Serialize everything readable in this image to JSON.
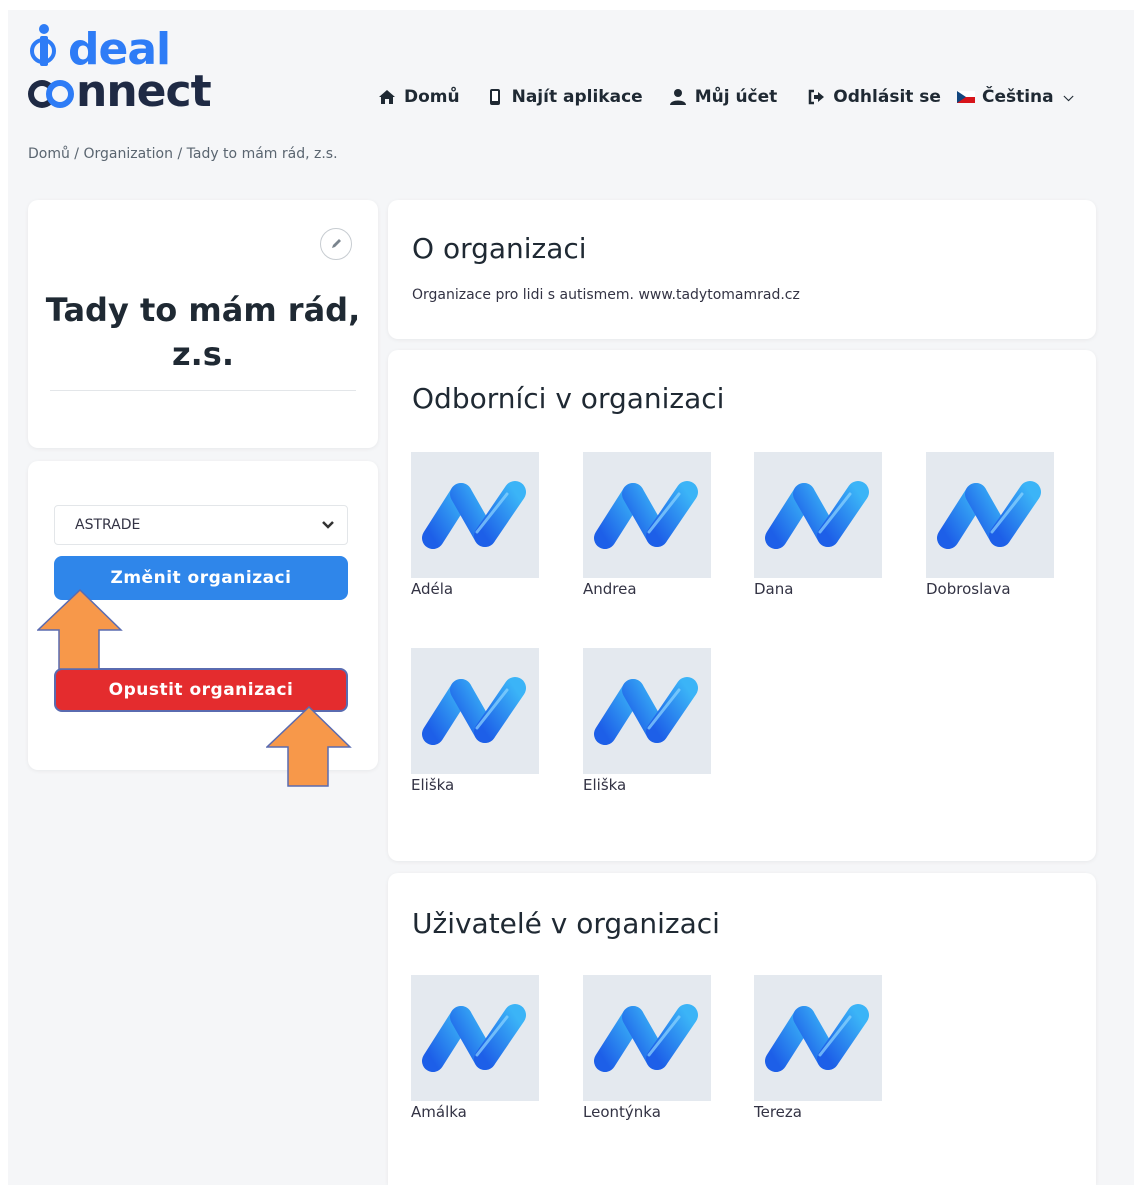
{
  "logo": {
    "line1": "deal",
    "line2": "nnect"
  },
  "nav": {
    "home": "Domů",
    "find_apps": "Najít aplikace",
    "account": "Můj účet",
    "logout": "Odhlásit se",
    "language": "Čeština"
  },
  "breadcrumb": {
    "home": "Domů",
    "sep": " / ",
    "organization": "Organization",
    "current": "Tady to mám rád, z.s."
  },
  "org": {
    "name": "Tady to mám rád, z.s.",
    "select_value": "ASTRADE",
    "change_button": "Změnit organizaci",
    "leave_button": "Opustit organizaci"
  },
  "about": {
    "title": "O organizaci",
    "text": "Organizace pro lidi s autismem. www.tadytomamrad.cz"
  },
  "experts": {
    "title": "Odborníci v organizaci",
    "people": [
      "Adéla",
      "Andrea",
      "Dana",
      "Dobroslava",
      "Eliška",
      "Eliška"
    ]
  },
  "users": {
    "title": "Uživatelé v organizaci",
    "people": [
      "Amálka",
      "Leontýnka",
      "Tereza"
    ]
  },
  "colors": {
    "brand_blue": "#2e7cf6",
    "button_blue": "#2f86ea",
    "button_red": "#e42c2e",
    "arrow_orange": "#f7984a"
  }
}
